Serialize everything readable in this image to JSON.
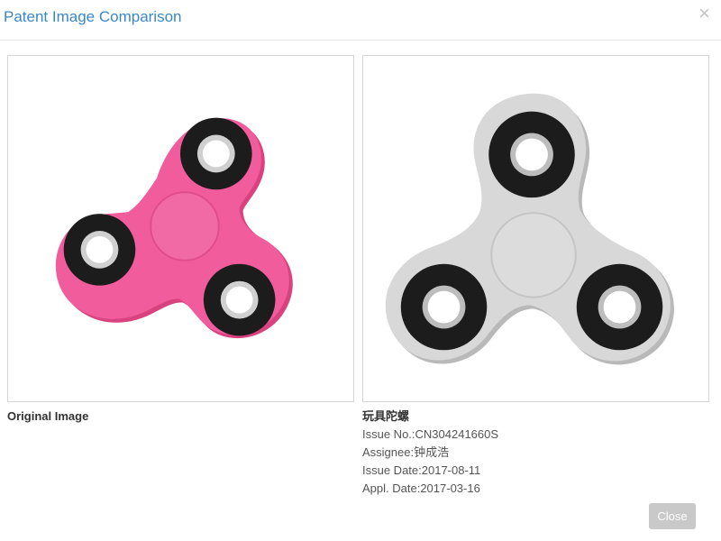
{
  "dialog": {
    "title": "Patent Image Comparison",
    "close_icon": "close-icon",
    "close_glyph": "×",
    "close_button_label": "Close"
  },
  "original": {
    "caption": "Original Image",
    "image_subject": "pink fidget spinner",
    "colors": {
      "body": "#f05c9c",
      "body_shadow": "#d8437f",
      "bearing": "#1c1c1c",
      "ring": "#c8c8c8"
    }
  },
  "match": {
    "image_subject": "grey fidget spinner",
    "name": "玩具陀螺",
    "issue_no": "Issue No.:CN304241660S",
    "assignee": "Assignee:钟成浩",
    "issue_date": "Issue Date:2017-08-11",
    "appl_date": "Appl. Date:2017-03-16",
    "colors": {
      "body": "#d6d6d6",
      "body_shadow": "#b9b9b9",
      "bearing": "#1c1c1c",
      "ring": "#cfcfcf"
    }
  },
  "colors": {
    "title": "#3a87c8",
    "button_bg": "#c9c9c9",
    "border": "#d6d6d6"
  }
}
